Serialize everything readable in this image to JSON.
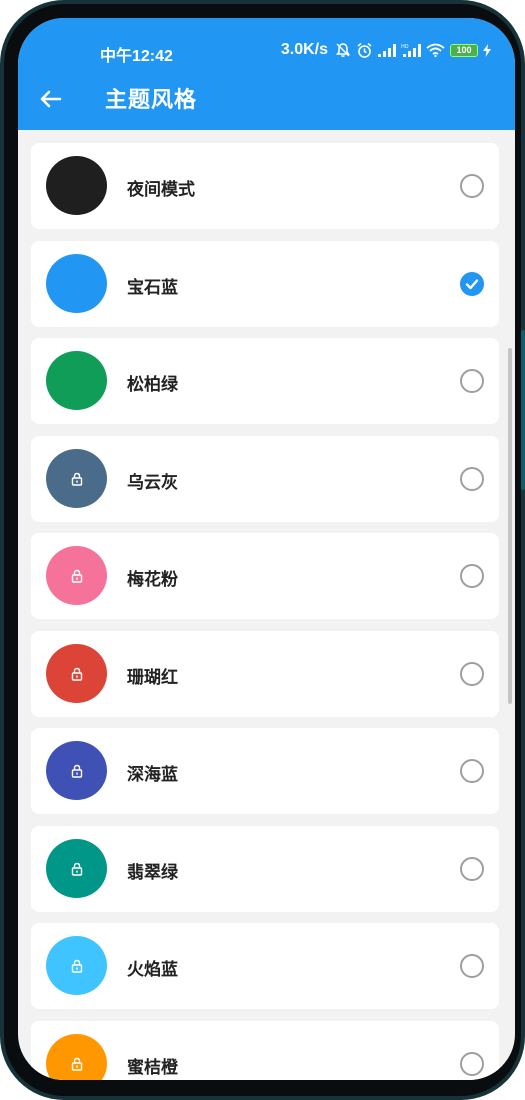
{
  "status_bar": {
    "time": "中午12:42",
    "network_speed": "3.0K/s",
    "battery": "100",
    "icons": [
      "bell-muted-icon",
      "alarm-icon",
      "signal-icon",
      "hd-signal-icon",
      "wifi-icon",
      "battery-icon",
      "charging-icon"
    ]
  },
  "app_bar": {
    "back_icon": "arrow-left-icon",
    "title": "主题风格"
  },
  "themes": [
    {
      "name": "夜间模式",
      "color": "#1f1f1f",
      "locked": false,
      "selected": false
    },
    {
      "name": "宝石蓝",
      "color": "#2196f3",
      "locked": false,
      "selected": true
    },
    {
      "name": "松柏绿",
      "color": "#0f9d58",
      "locked": false,
      "selected": false
    },
    {
      "name": "乌云灰",
      "color": "#4a6b8a",
      "locked": true,
      "selected": false
    },
    {
      "name": "梅花粉",
      "color": "#f5739a",
      "locked": true,
      "selected": false
    },
    {
      "name": "珊瑚红",
      "color": "#db4437",
      "locked": true,
      "selected": false
    },
    {
      "name": "深海蓝",
      "color": "#3f51b5",
      "locked": true,
      "selected": false
    },
    {
      "name": "翡翠绿",
      "color": "#009688",
      "locked": true,
      "selected": false
    },
    {
      "name": "火焰蓝",
      "color": "#40c4ff",
      "locked": true,
      "selected": false
    },
    {
      "name": "蜜桔橙",
      "color": "#ff9800",
      "locked": true,
      "selected": false
    }
  ]
}
